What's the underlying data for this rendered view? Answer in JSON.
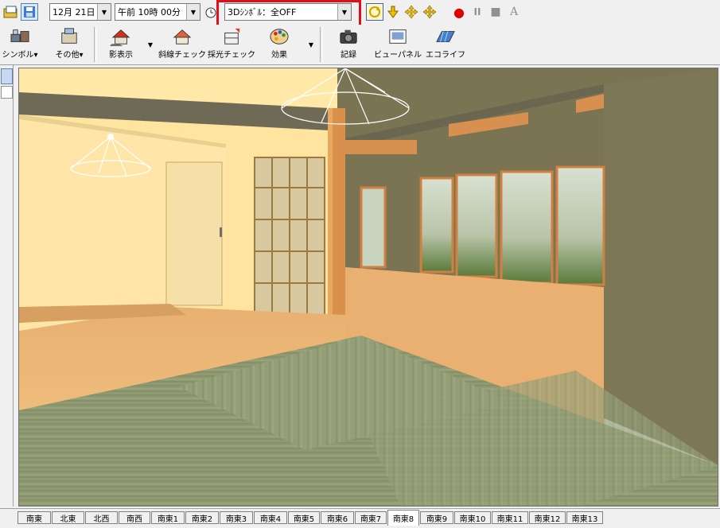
{
  "toolbar_top": {
    "date_value": "12月 21日",
    "time_value": "午前 10時 00分",
    "symbol_mode_value": "3Dｼﾝﾎﾞﾙ：全OFF",
    "record_label": "●",
    "pause_label": "II",
    "stop_label": "■",
    "text_label": "A"
  },
  "toolbar_main": {
    "symbol_label": "シンボル▾",
    "other_label": "その他▾",
    "shadow_label": "影表示",
    "slope_label": "斜線チェック",
    "daylight_label": "採光チェック",
    "effect_label": "効果",
    "record_label": "記録",
    "viewpanel_label": "ビューパネル",
    "ecolife_label": "エコライフ"
  },
  "view_tabs": [
    "南東",
    "北東",
    "北西",
    "南西",
    "南東1",
    "南東2",
    "南東3",
    "南東4",
    "南東5",
    "南東6",
    "南東7",
    "南東8",
    "南東9",
    "南東10",
    "南東11",
    "南東12",
    "南東13"
  ],
  "active_tab": "南東8",
  "colors": {
    "highlight": "#e0101b",
    "record_red": "#e00000"
  }
}
